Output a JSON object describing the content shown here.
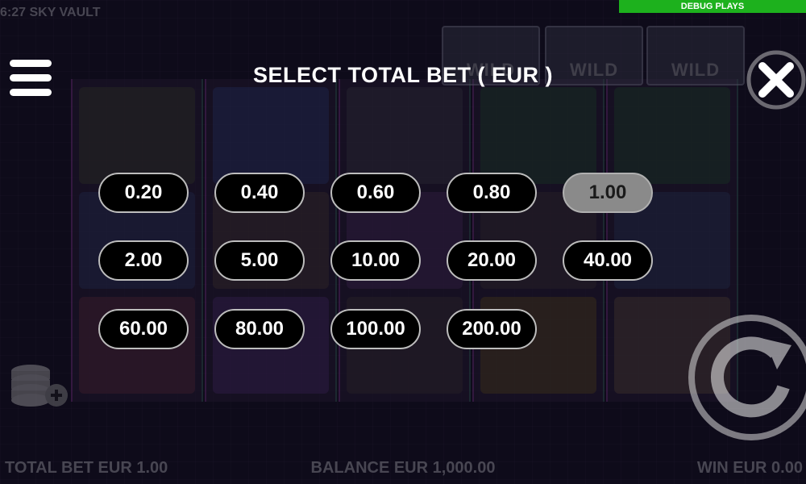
{
  "top_bar": {
    "clock_title": "6:27  SKY VAULT",
    "debug_label": "DEBUG PLAYS"
  },
  "dialog": {
    "title": "SELECT TOTAL BET ( EUR )",
    "bet_options": [
      "0.20",
      "0.40",
      "0.60",
      "0.80",
      "1.00",
      "2.00",
      "5.00",
      "10.00",
      "20.00",
      "40.00",
      "60.00",
      "80.00",
      "100.00",
      "200.00"
    ],
    "selected_bet": "1.00"
  },
  "reels": {
    "wild_label": "WILD"
  },
  "bottom_bar": {
    "total_bet": "TOTAL BET EUR 1.00",
    "balance": "BALANCE EUR 1,000.00",
    "win": "WIN EUR 0.00"
  },
  "icons": {
    "menu": "hamburger-menu-icon",
    "close": "close-icon",
    "coins": "coin-stack-plus-icon",
    "spin": "spin-arrow-icon"
  },
  "colors": {
    "debug_bg": "#1db11d",
    "selected_bet_bg": "#8a8a8a",
    "bet_bg": "#000000",
    "bet_border": "#bdbdbd"
  }
}
